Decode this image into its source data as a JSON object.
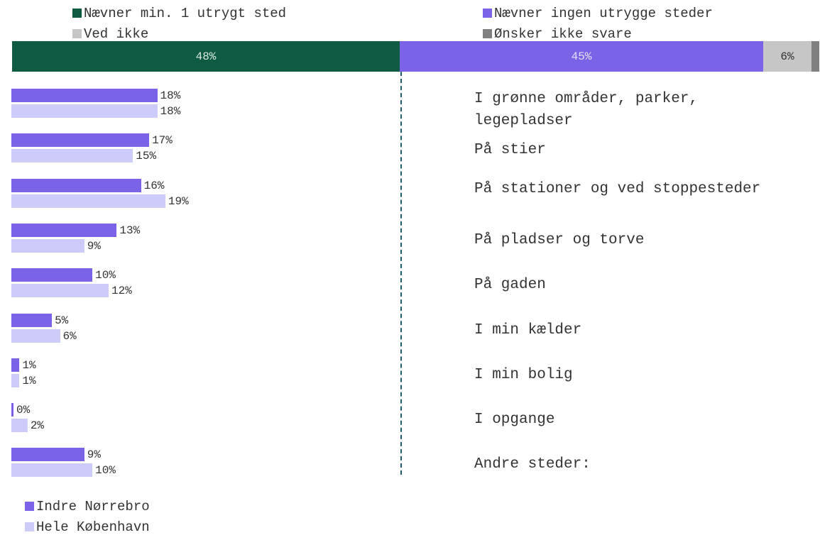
{
  "chart_data": [
    {
      "type": "bar",
      "orientation": "horizontal-stacked",
      "legend_position": "top",
      "segments": [
        {
          "name": "Nævner min. 1 utrygt sted",
          "value": 48,
          "label": "48%",
          "color": "#0f5a43",
          "text_color": "#d9e7e0"
        },
        {
          "name": "Nævner ingen utrygge steder",
          "value": 45,
          "label": "45%",
          "color": "#7c62e6",
          "text_color": "#e6e0fb"
        },
        {
          "name": "Ved ikke",
          "value": 6,
          "label": "6%",
          "color": "#c6c6c6",
          "text_color": "#333333"
        },
        {
          "name": "Ønsker ikke svare",
          "value": 1,
          "label": "",
          "color": "#808080",
          "text_color": "#333333"
        }
      ]
    },
    {
      "type": "bar",
      "orientation": "horizontal",
      "legend_position": "bottom-left",
      "xlim": [
        0,
        48
      ],
      "categories": [
        "I grønne områder, parker, legepladser",
        "På stier",
        "På stationer og ved stoppesteder",
        "På pladser og torve",
        "På gaden",
        "I min kælder",
        "I min bolig",
        "I opgange",
        "Andre steder:"
      ],
      "series": [
        {
          "name": "Indre Nørrebro",
          "color": "#7c62e6",
          "values": [
            18,
            17,
            16,
            13,
            10,
            5,
            1,
            0,
            9
          ],
          "labels": [
            "18%",
            "17%",
            "16%",
            "13%",
            "10%",
            "5%",
            "1%",
            "0%",
            "9%"
          ]
        },
        {
          "name": "Hele København",
          "color": "#cccbfa",
          "values": [
            18,
            15,
            19,
            9,
            12,
            6,
            1,
            2,
            10
          ],
          "labels": [
            "18%",
            "15%",
            "19%",
            "9%",
            "12%",
            "6%",
            "1%",
            "2%",
            "10%"
          ]
        }
      ]
    }
  ]
}
